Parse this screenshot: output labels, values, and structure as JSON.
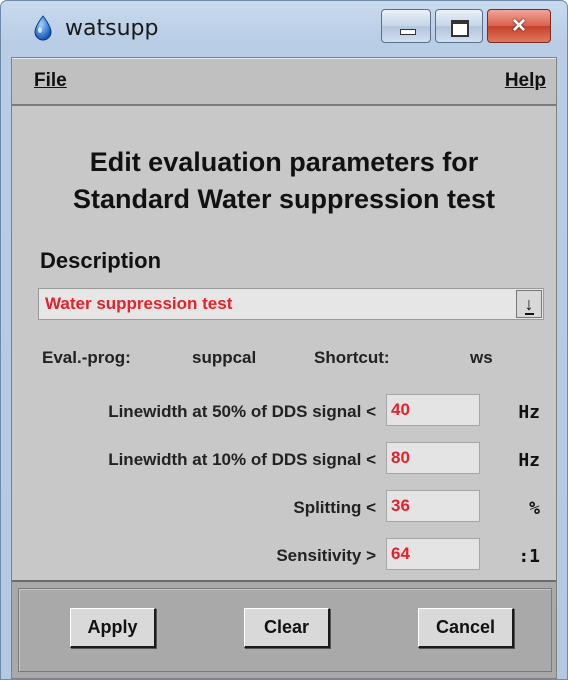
{
  "window": {
    "title": "watsupp",
    "close_glyph": "×"
  },
  "menu": {
    "file_label": "File",
    "help_label": "Help"
  },
  "heading": {
    "line1": "Edit evaluation parameters for",
    "line2": "Standard Water suppression test"
  },
  "description": {
    "label": "Description",
    "selected": "Water suppression test",
    "dropdown_icon": "↓"
  },
  "info": {
    "eval_prog_label": "Eval.-prog:",
    "eval_prog_value": "suppcal",
    "shortcut_label": "Shortcut:",
    "shortcut_value": "ws"
  },
  "params": [
    {
      "label": "Linewidth at 50% of DDS signal <",
      "value": "40",
      "unit": "Hz"
    },
    {
      "label": "Linewidth at 10% of DDS signal <",
      "value": "80",
      "unit": "Hz"
    },
    {
      "label": "Splitting <",
      "value": "36",
      "unit": "%"
    },
    {
      "label": "Sensitivity >",
      "value": "64",
      "unit": ":1"
    }
  ],
  "buttons": {
    "apply": "Apply",
    "clear": "Clear",
    "cancel": "Cancel"
  },
  "colors": {
    "value_text": "#e8202a",
    "panel": "#c8c8c8",
    "title_bar": "#b9cde6"
  },
  "icons": [
    "water-drop-icon",
    "minimize-icon",
    "maximize-icon",
    "close-icon",
    "dropdown-arrow-icon"
  ]
}
